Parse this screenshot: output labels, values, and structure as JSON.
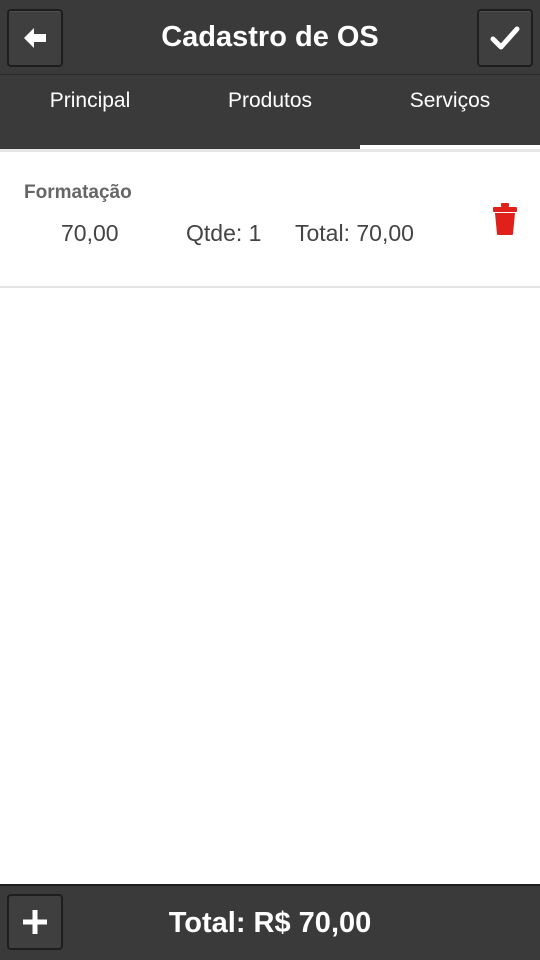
{
  "header": {
    "title": "Cadastro de OS",
    "back_icon": "arrow-left-icon",
    "confirm_icon": "checkmark-icon"
  },
  "tabs": [
    {
      "label": "Principal",
      "active": false
    },
    {
      "label": "Produtos",
      "active": false
    },
    {
      "label": "Serviços",
      "active": true
    }
  ],
  "services": [
    {
      "name": "Formatação",
      "price": "70,00",
      "qty": "Qtde: 1",
      "total": "Total: 70,00",
      "delete_icon": "trash-icon"
    }
  ],
  "footer": {
    "add_icon": "plus-icon",
    "total": "Total: R$ 70,00"
  },
  "colors": {
    "bar_background": "#3a3a3a",
    "delete_red": "#e0201b"
  }
}
